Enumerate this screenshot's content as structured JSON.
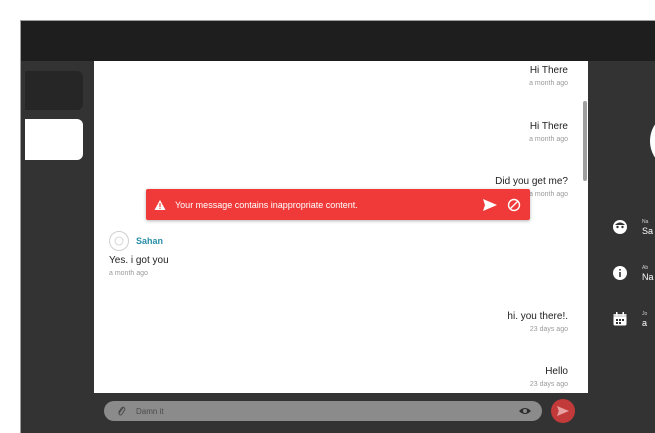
{
  "messages": [
    {
      "text": "Hi There",
      "time": "a month ago",
      "side": "right"
    },
    {
      "text": "Hi There",
      "time": "a month ago",
      "side": "right"
    },
    {
      "text": "Did you get me?",
      "time": "a month ago",
      "side": "right"
    },
    {
      "text": "Yes. i got you",
      "time": "a month ago",
      "side": "left",
      "sender": "Sahan"
    },
    {
      "text": "hi. you there!.",
      "time": "23 days ago",
      "side": "right"
    },
    {
      "text": "Hello",
      "time": "23 days ago",
      "side": "right"
    }
  ],
  "toast": {
    "text": "Your message contains inappropriate content.",
    "color": "#f03a3a"
  },
  "composer": {
    "draft": "Damn it"
  },
  "profile": {
    "rows": [
      {
        "label": "Na",
        "value": "Sa",
        "icon": "face-icon"
      },
      {
        "label": "Ab",
        "value": "Na",
        "icon": "info-icon"
      },
      {
        "label": "Jo",
        "value": "a",
        "icon": "calendar-icon"
      }
    ]
  },
  "colors": {
    "accent": "#2a8fa8",
    "send": "#c33a3a",
    "dark": "#333333"
  }
}
